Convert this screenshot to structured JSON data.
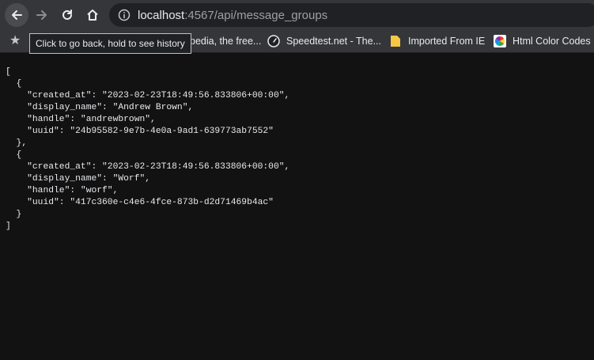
{
  "browser": {
    "url_host": "localhost",
    "url_rest": ":4567/api/message_groups",
    "back_tooltip": "Click to go back, hold to see history"
  },
  "bookmarks": [
    {
      "label": "pedia, the free...",
      "icon": "wikipedia-icon"
    },
    {
      "label": "Speedtest.net - The...",
      "icon": "speedtest-icon"
    },
    {
      "label": "Imported From IE",
      "icon": "folder-icon"
    },
    {
      "label": "Html Color Codes",
      "icon": "color-wheel-icon"
    }
  ],
  "json_lines": [
    "[",
    "  {",
    "    \"created_at\": \"2023-02-23T18:49:56.833806+00:00\",",
    "    \"display_name\": \"Andrew Brown\",",
    "    \"handle\": \"andrewbrown\",",
    "    \"uuid\": \"24b95582-9e7b-4e0a-9ad1-639773ab7552\"",
    "  },",
    "  {",
    "    \"created_at\": \"2023-02-23T18:49:56.833806+00:00\",",
    "    \"display_name\": \"Worf\",",
    "    \"handle\": \"worf\",",
    "    \"uuid\": \"417c360e-c4e6-4fce-873b-d2d71469b4ac\"",
    "  }",
    "]"
  ]
}
